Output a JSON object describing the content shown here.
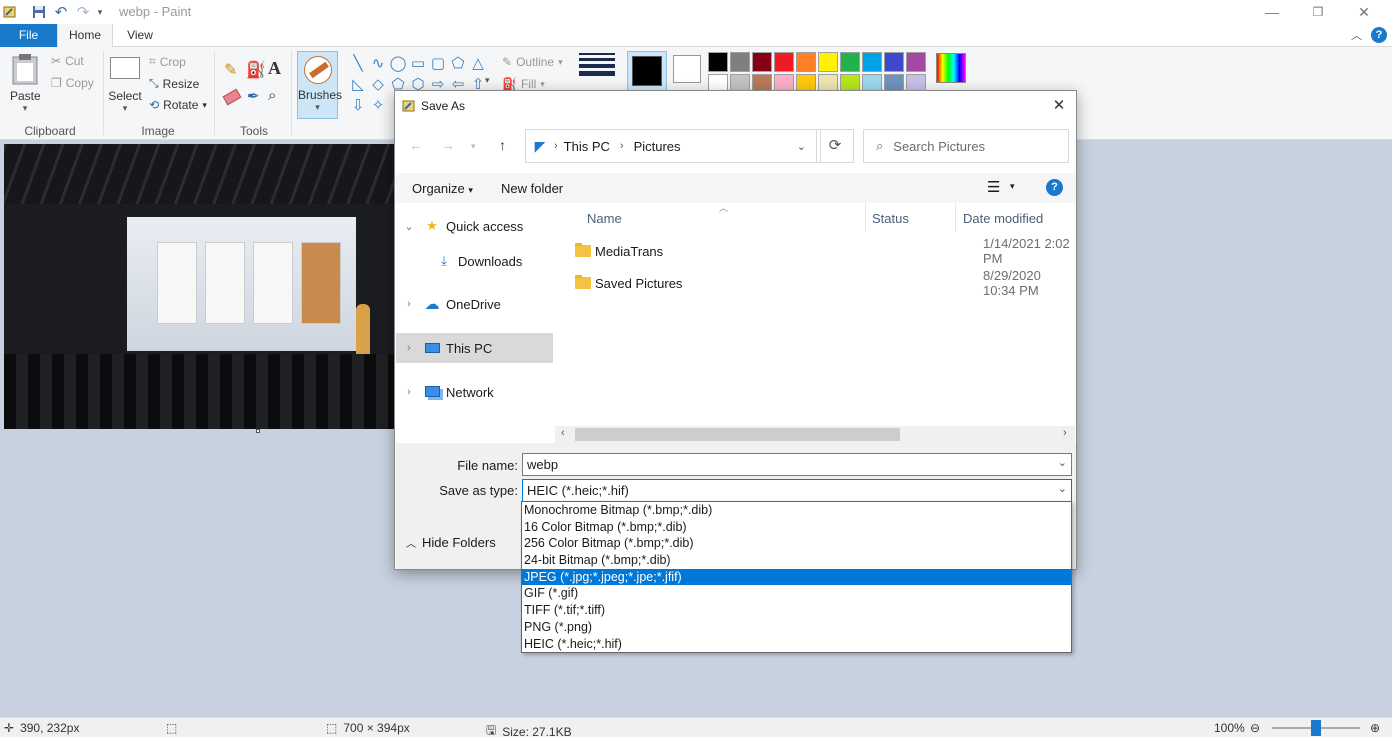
{
  "app": {
    "title": "webp - Paint"
  },
  "tabs": {
    "file": "File",
    "home": "Home",
    "view": "View"
  },
  "ribbon": {
    "clipboard": {
      "paste": "Paste",
      "cut": "Cut",
      "copy": "Copy",
      "group": "Clipboard"
    },
    "image": {
      "select": "Select",
      "crop": "Crop",
      "resize": "Resize",
      "rotate": "Rotate",
      "group": "Image"
    },
    "tools": {
      "group": "Tools"
    },
    "brushes": "Brushes",
    "shapes": {
      "outline": "Outline",
      "fill": "Fill"
    },
    "palette": [
      "#000000",
      "#7f7f7f",
      "#880015",
      "#ed1c24",
      "#ff7f27",
      "#fff200",
      "#22b14c",
      "#00a2e8",
      "#3f48cc",
      "#a349a4",
      "#ffffff",
      "#c3c3c3",
      "#b97a57",
      "#ffaec9",
      "#ffc90e",
      "#efe4b0",
      "#b5e61d",
      "#99d9ea",
      "#7092be",
      "#c8bfe7"
    ]
  },
  "status": {
    "position": "390, 232px",
    "dimensions": "700 × 394px",
    "size": "Size: 27.1KB",
    "zoom": "100%",
    "zoom_level": 0.5
  },
  "dialog": {
    "title": "Save As",
    "breadcrumb": [
      "This PC",
      "Pictures"
    ],
    "search_placeholder": "Search Pictures",
    "organize": "Organize",
    "new_folder": "New folder",
    "nav": {
      "quick_access": "Quick access",
      "downloads": "Downloads",
      "onedrive": "OneDrive",
      "this_pc": "This PC",
      "network": "Network"
    },
    "columns": {
      "name": "Name",
      "status": "Status",
      "date": "Date modified"
    },
    "files": [
      {
        "name": "MediaTrans",
        "date": "1/14/2021 2:02 PM"
      },
      {
        "name": "Saved Pictures",
        "date": "8/29/2020 10:34 PM"
      }
    ],
    "file_name_label": "File name:",
    "file_name": "webp",
    "save_type_label": "Save as type:",
    "save_type": "HEIC (*.heic;*.hif)",
    "hide_folders": "Hide Folders",
    "type_options": [
      "Monochrome Bitmap (*.bmp;*.dib)",
      "16 Color Bitmap (*.bmp;*.dib)",
      "256 Color Bitmap (*.bmp;*.dib)",
      "24-bit Bitmap (*.bmp;*.dib)",
      "JPEG (*.jpg;*.jpeg;*.jpe;*.jfif)",
      "GIF (*.gif)",
      "TIFF (*.tif;*.tiff)",
      "PNG (*.png)",
      "HEIC (*.heic;*.hif)"
    ],
    "selected_type_index": 4
  }
}
